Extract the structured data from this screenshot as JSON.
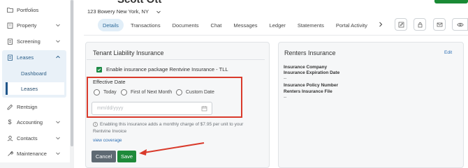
{
  "header": {
    "title": "Scott Ott",
    "address": "123 Bowery New York, NY"
  },
  "sidebar": {
    "items": [
      {
        "label": "Portfolios",
        "icon": "folder-icon"
      },
      {
        "label": "Property",
        "icon": "building-icon"
      },
      {
        "label": "Screening",
        "icon": "clipboard-icon"
      },
      {
        "label": "Leases",
        "icon": "document-icon"
      },
      {
        "label": "Rentsign",
        "icon": "signature-icon"
      },
      {
        "label": "Accounting",
        "icon": "dollar-icon"
      },
      {
        "label": "Contacts",
        "icon": "user-icon"
      },
      {
        "label": "Maintenance",
        "icon": "wrench-icon"
      }
    ],
    "leases_sub": [
      "Dashboard",
      "Leases"
    ]
  },
  "tabs": [
    "Details",
    "Transactions",
    "Documents",
    "Chat",
    "Messages",
    "Ledger",
    "Statements",
    "Portal Activity"
  ],
  "tli": {
    "title": "Tenant Liability Insurance",
    "enable_label": "Enable insurance package Rentvine Insurance - TLL",
    "effective_date_label": "Effective Date",
    "options": [
      "Today",
      "First of Next Month",
      "Custom Date"
    ],
    "date_placeholder": "mm/dd/yyyy",
    "info_line1": "Enabling this insurance adds a monthly charge of $7.95 per unit to your",
    "info_line2": "Rentvine Invoice",
    "view_coverage": "view coverage",
    "cancel": "Cancel",
    "save": "Save"
  },
  "renters": {
    "title": "Renters Insurance",
    "edit": "Edit",
    "fields": [
      {
        "label": "Insurance Company",
        "value": ""
      },
      {
        "label": "Insurance Expiration Date",
        "value": "--"
      },
      {
        "label": "Insurance Policy Number",
        "value": ""
      },
      {
        "label": "Renters Insurance File",
        "value": "--"
      }
    ]
  },
  "colors": {
    "accent": "#2d6a9a",
    "save_green": "#1e8a3a",
    "highlight_red": "#d93a2b"
  }
}
